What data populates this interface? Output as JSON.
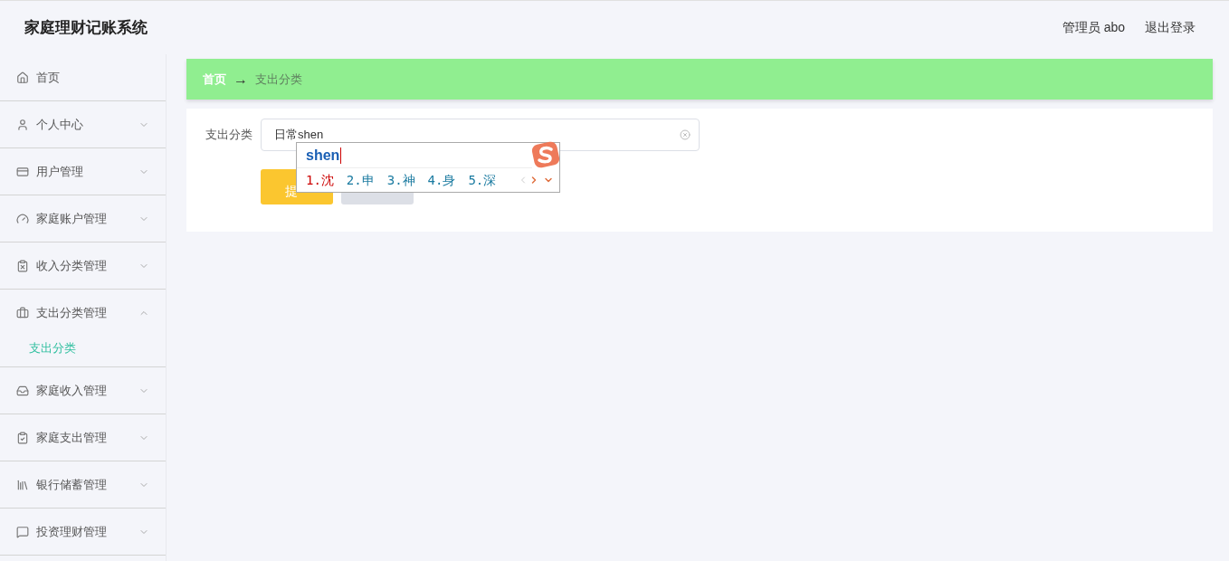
{
  "header": {
    "title": "家庭理财记账系统",
    "user": "管理员 abo",
    "logout": "退出登录"
  },
  "sidebar": {
    "items": [
      {
        "label": "首页"
      },
      {
        "label": "个人中心",
        "expanded": false
      },
      {
        "label": "用户管理",
        "expanded": false
      },
      {
        "label": "家庭账户管理",
        "expanded": false
      },
      {
        "label": "收入分类管理",
        "expanded": false
      },
      {
        "label": "支出分类管理",
        "expanded": true,
        "children": [
          {
            "label": "支出分类",
            "selected": true
          }
        ]
      },
      {
        "label": "家庭收入管理",
        "expanded": false
      },
      {
        "label": "家庭支出管理",
        "expanded": false
      },
      {
        "label": "银行储蓄管理",
        "expanded": false
      },
      {
        "label": "投资理财管理",
        "expanded": false
      }
    ]
  },
  "breadcrumb": [
    "首页",
    "→",
    "支出分类"
  ],
  "form": {
    "label": "支出分类",
    "value": "日常shen",
    "buttons": [
      {
        "kind": "submit",
        "label": "提"
      },
      {
        "kind": "reset"
      }
    ]
  },
  "ime": {
    "composition": "shen",
    "candidates": [
      {
        "label": "1.沈",
        "selected": true
      },
      {
        "label": "2.申",
        "selected": false
      },
      {
        "label": "3.神",
        "selected": false
      },
      {
        "label": "4.身",
        "selected": false
      },
      {
        "label": "5.深",
        "selected": false
      }
    ]
  }
}
